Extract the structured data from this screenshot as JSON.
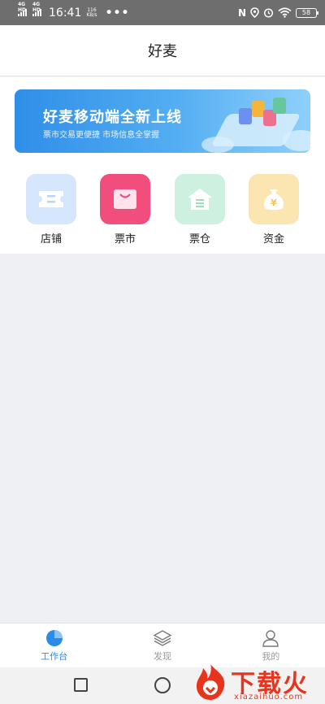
{
  "status_bar": {
    "network1": "4G HD",
    "network2": "4G HD",
    "time": "16:41",
    "speed_value": "116",
    "speed_unit": "KB/s",
    "dots": "•••",
    "nfc": "N",
    "battery": "58"
  },
  "header": {
    "title": "好麦"
  },
  "banner": {
    "title": "好麦移动端全新上线",
    "subtitle": "票市交易更便捷   市场信息全掌握"
  },
  "shortcuts": [
    {
      "label": "店铺",
      "icon": "ticket-icon"
    },
    {
      "label": "票市",
      "icon": "shopping-bag-icon"
    },
    {
      "label": "票仓",
      "icon": "warehouse-icon"
    },
    {
      "label": "资金",
      "icon": "money-bag-icon"
    }
  ],
  "tabbar": {
    "tabs": [
      {
        "label": "工作台",
        "icon": "pie-chart-icon",
        "active": true
      },
      {
        "label": "发现",
        "icon": "layers-icon",
        "active": false
      },
      {
        "label": "我的",
        "icon": "person-icon",
        "active": false
      }
    ]
  },
  "watermark": {
    "text": "下载火",
    "url": "xiazaihuo.com"
  },
  "colors": {
    "accent": "#2a8ce6",
    "banner_start": "#2f8ee8",
    "banner_end": "#8fd0fb",
    "shop": "#d6e6fd",
    "market": "#f14d7d",
    "store": "#cdf0e0",
    "fund": "#fbe6b1"
  }
}
